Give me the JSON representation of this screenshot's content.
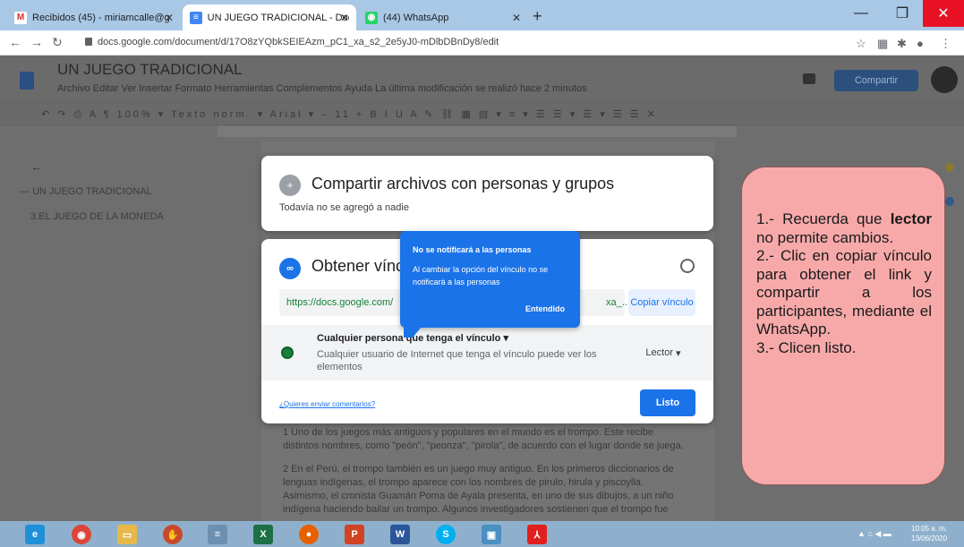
{
  "browser": {
    "tabs": [
      {
        "label": "Recibidos (45) - miriamcalle@g",
        "icon": "gmail-icon"
      },
      {
        "label": "UN JUEGO TRADICIONAL - Doc",
        "icon": "docs-icon"
      },
      {
        "label": "(44) WhatsApp",
        "icon": "whatsapp-icon"
      }
    ],
    "url": "docs.google.com/document/d/17O8zYQbkSEIEAzm_pC1_xa_s2_2e5yJ0-mDlbDBnDy8/edit"
  },
  "docs": {
    "title": "UN JUEGO TRADICIONAL",
    "menus": "Archivo  Editar  Ver  Insertar  Formato  Herramientas  Complementos  Ayuda     La última modificación se realizó hace 2 minutos",
    "share_label": "Compartir",
    "toolbar": "↶ ↷ ⎙ A ¶  100% ▾  Texto norm. ▾  Arial ▾  – 11 +  B I U A ✎  ⛓ ▦ ▤ ▾  ≡ ▾  ☰ ☰ ▾ ☰ ▾ ☰ ☰ ✕",
    "outline": [
      "UN JUEGO TRADICIONAL",
      "3.EL JUEGO DE LA MONEDA"
    ],
    "body_lines": [
      "1 Uno de los juegos más antiguos y populares en el mundo es el trompo. Este recibe",
      "distintos nombres, como \"peón\", \"peonza\", \"pirola\", de acuerdo con el lugar donde se juega.",
      "",
      "2 En el Perú, el trompo también es un juego muy antiguo. En los primeros diccionarios de",
      "lenguas indígenas, el trompo aparece con los nombres de pirulo, hirula y piscoylla.",
      "Asimismo, el cronista Guamán Poma de Ayala presenta, en uno de sus dibujos, a un niño",
      "indígena haciendo bailar un trompo. Algunos investigadores sostienen que el trompo fue"
    ]
  },
  "share_dialog": {
    "people_title": "Compartir archivos con personas y grupos",
    "people_subtitle": "Todavía no se agregó a nadie",
    "link_title": "Obtener vínculo",
    "link_value": "https://docs.google.com/",
    "link_tail": "xa_...",
    "copy_link": "Copiar vínculo",
    "access_label": "Cualquier persona que tenga el vínculo",
    "access_desc": "Cualquier usuario de Internet que tenga el vínculo puede ver los elementos",
    "role": "Lector",
    "feedback": "¿Quieres enviar comentarios?",
    "done": "Listo"
  },
  "tooltip": {
    "title": "No se notificará a las personas",
    "body": "Al cambiar la opción del vínculo no se notificará a las personas",
    "button": "Entendido"
  },
  "note": {
    "line1_pre": "1.- Recuerda que",
    "line1_bold": "lector",
    "line1_post": "no permite cambios.",
    "line2": "2.- Clic en copiar vínculo para obtener el link y compartir a los participantes, mediante el WhatsApp.",
    "line3": "3.- Clicen listo."
  },
  "taskbar": {
    "tray": "▲ ⌂ ◀ ▬",
    "time": "10:05 a. m.",
    "date": "13/06/2020"
  }
}
